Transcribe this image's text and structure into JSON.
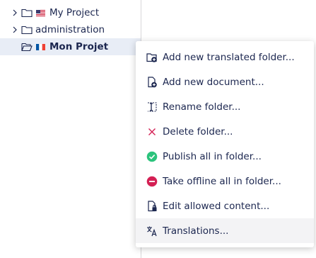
{
  "tree": {
    "nodes": [
      {
        "label": "My Project",
        "flag": "us-flag-icon"
      },
      {
        "label": "administration"
      },
      {
        "label": "Mon Projet",
        "flag": "fr-flag-icon",
        "selected": true
      }
    ]
  },
  "menu": {
    "items": [
      {
        "label": "Add new translated folder...",
        "icon": "add-translated-folder-icon"
      },
      {
        "label": "Add new document...",
        "icon": "add-document-icon"
      },
      {
        "label": "Rename folder...",
        "icon": "rename-icon"
      },
      {
        "label": "Delete folder...",
        "icon": "delete-icon"
      },
      {
        "label": "Publish all in folder...",
        "icon": "publish-icon"
      },
      {
        "label": "Take offline all in folder...",
        "icon": "offline-icon"
      },
      {
        "label": "Edit allowed content...",
        "icon": "edit-allowed-content-icon"
      },
      {
        "label": "Translations...",
        "icon": "translations-icon"
      }
    ]
  },
  "colors": {
    "text": "#1b264f",
    "selected_bg": "#e8edf6",
    "delete": "#d42054",
    "publish": "#2bc37c",
    "offline": "#d42054"
  }
}
